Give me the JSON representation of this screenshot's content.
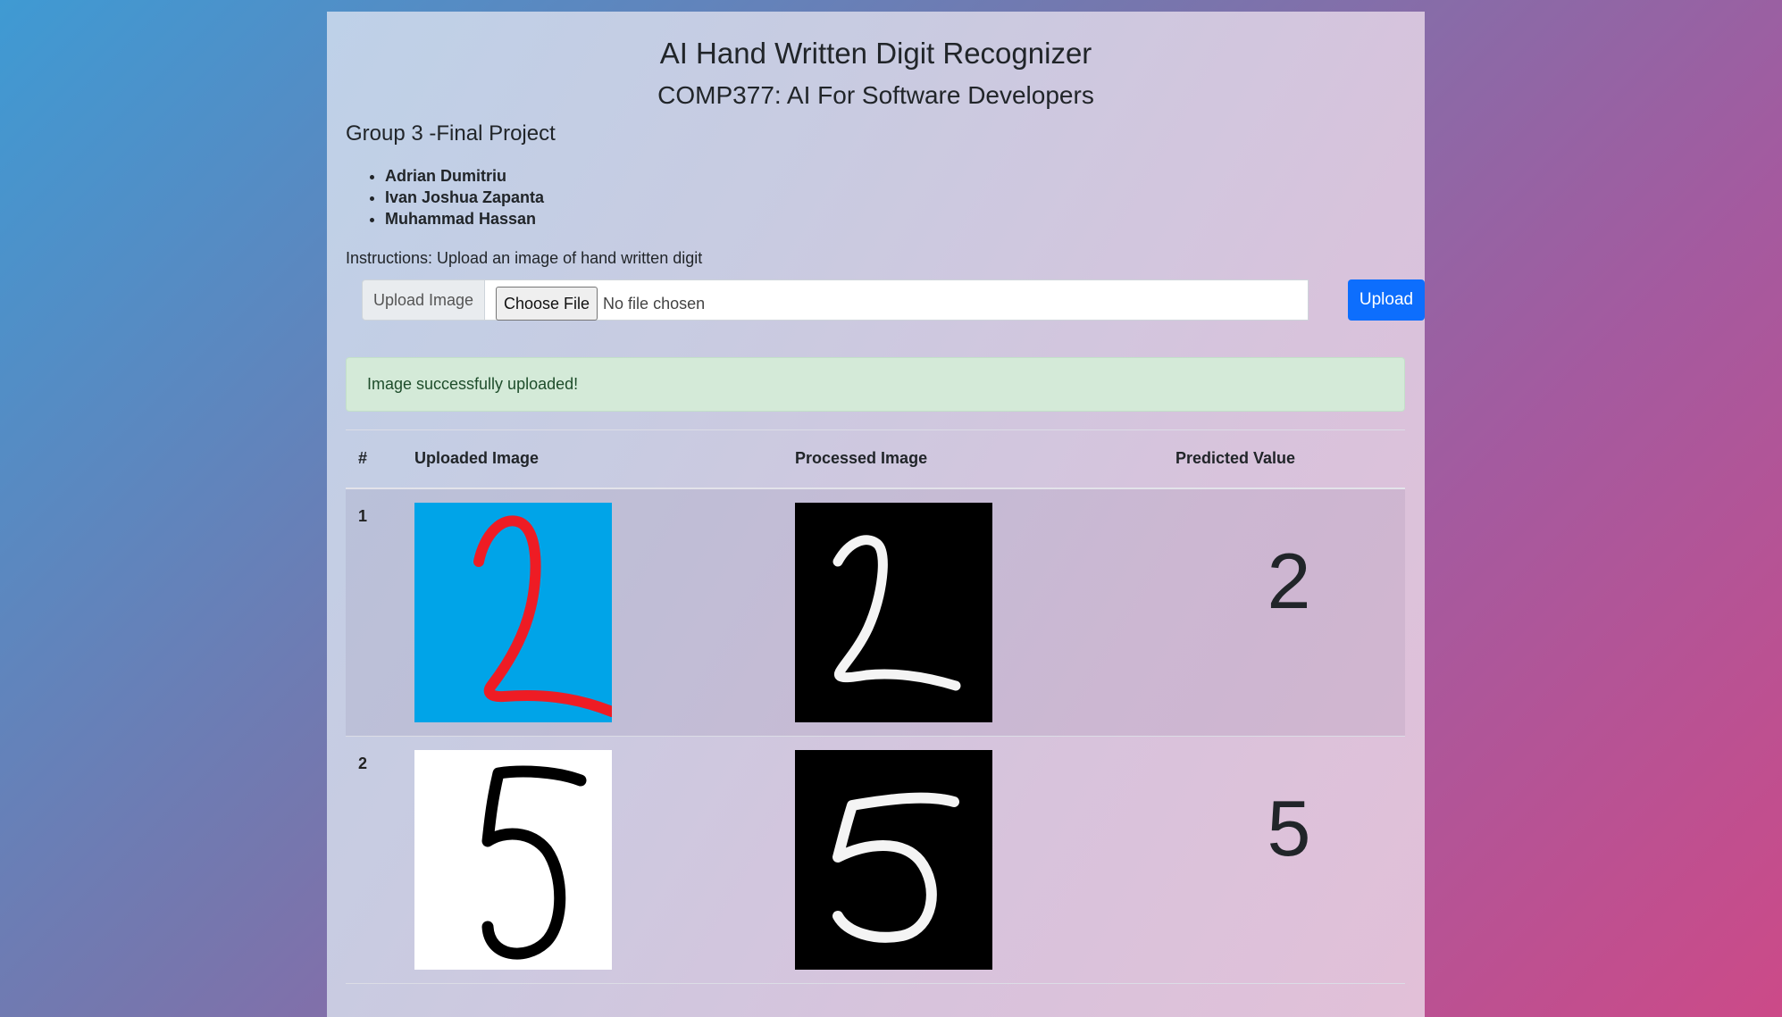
{
  "header": {
    "title": "AI Hand Written Digit Recognizer",
    "subtitle": "COMP377: AI For Software Developers"
  },
  "group": {
    "title": "Group 3 -Final Project",
    "members": [
      "Adrian Dumitriu",
      "Ivan Joshua Zapanta",
      "Muhammad Hassan"
    ]
  },
  "instructions": "Instructions: Upload an image of hand written digit",
  "upload": {
    "prepend_label": "Upload Image",
    "choose_file_label": "Choose File",
    "file_status": "No file chosen",
    "button_label": "Upload"
  },
  "alert": {
    "message": "Image successfully uploaded!"
  },
  "table": {
    "headers": [
      "#",
      "Uploaded Image",
      "Processed Image",
      "Predicted Value"
    ],
    "rows": [
      {
        "num": "1",
        "predicted": "2",
        "uploaded_bg": "#00a4e8",
        "uploaded_stroke": "#ee1c24"
      },
      {
        "num": "2",
        "predicted": "5",
        "uploaded_bg": "#ffffff",
        "uploaded_stroke": "#000000"
      }
    ]
  },
  "colors": {
    "accent": "#0d6efd",
    "alert_bg": "#d4ead8"
  }
}
